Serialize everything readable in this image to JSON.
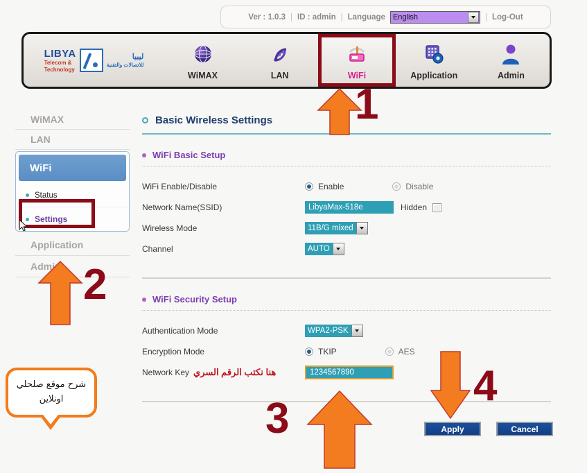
{
  "topbar": {
    "version": "Ver : 1.0.3",
    "user_id": "ID : admin",
    "language_label": "Language",
    "language_value": "English",
    "logout": "Log-Out",
    "sep": "|"
  },
  "nav": {
    "logo": {
      "brand": "LIBYA",
      "line2": "Telecom &",
      "line3": "Technology",
      "arabic_main": "ليبيا",
      "arabic_sub": "للاتصالات والتقنية"
    },
    "items": [
      {
        "label": "WiMAX",
        "icon": "globe-icon",
        "active": false
      },
      {
        "label": "LAN",
        "icon": "signal-icon",
        "active": false
      },
      {
        "label": "WiFi",
        "icon": "router-icon",
        "active": true
      },
      {
        "label": "Application",
        "icon": "apps-gear-icon",
        "active": false
      },
      {
        "label": "Admin",
        "icon": "user-icon",
        "active": false
      }
    ]
  },
  "sidebar": {
    "top_items": [
      "WiMAX",
      "LAN"
    ],
    "section_title": "WiFi",
    "sub_items": [
      {
        "label": "Status",
        "selected": false
      },
      {
        "label": "Settings",
        "selected": true
      }
    ],
    "bottom_items": [
      "Application",
      "Admin"
    ]
  },
  "main": {
    "page_title": "Basic Wireless Settings",
    "basic_section": {
      "title": "WiFi Basic Setup",
      "rows": {
        "enable_label": "WiFi Enable/Disable",
        "enable_option": "Enable",
        "disable_option": "Disable",
        "ssid_label": "Network Name(SSID)",
        "ssid_value": "LibyaMax-518e",
        "hidden_label": "Hidden",
        "wireless_mode_label": "Wireless Mode",
        "wireless_mode_value": "11B/G mixed",
        "channel_label": "Channel",
        "channel_value": "AUTO"
      }
    },
    "security_section": {
      "title": "WiFi Security Setup",
      "rows": {
        "auth_label": "Authentication Mode",
        "auth_value": "WPA2-PSK",
        "encryption_label": "Encryption Mode",
        "encryption_option_tkip": "TKIP",
        "encryption_option_aes": "AES",
        "key_label": "Network Key",
        "key_note_arabic": "هنا نكتب الرقم السري",
        "key_value": "1234567890"
      }
    },
    "buttons": {
      "apply": "Apply",
      "cancel": "Cancel"
    }
  },
  "annotations": {
    "steps": [
      "1",
      "2",
      "3",
      "4"
    ],
    "callout_line1": "شرح موقع صلحلي",
    "callout_line2": "اونلاين"
  },
  "colors": {
    "accent_teal": "#2e9fb5",
    "annotation_red": "#8b0b18",
    "arrow_orange": "#f07c1e",
    "title_blue": "#1f3f6e",
    "section_purple": "#7b3fb0",
    "button_blue": "#1b4f9c",
    "language_purple": "#bb8df0"
  }
}
